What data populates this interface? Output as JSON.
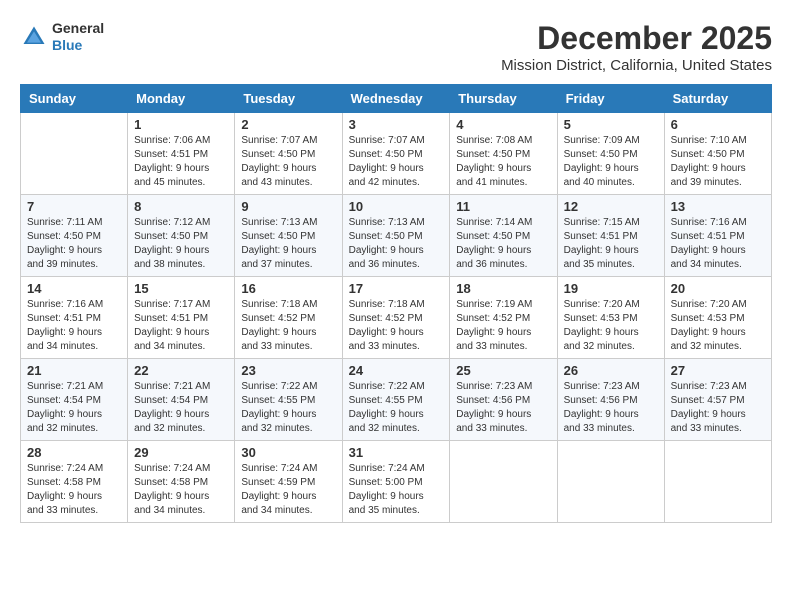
{
  "logo": {
    "general": "General",
    "blue": "Blue"
  },
  "header": {
    "month": "December 2025",
    "location": "Mission District, California, United States"
  },
  "days_of_week": [
    "Sunday",
    "Monday",
    "Tuesday",
    "Wednesday",
    "Thursday",
    "Friday",
    "Saturday"
  ],
  "weeks": [
    [
      {
        "day": "",
        "info": ""
      },
      {
        "day": "1",
        "info": "Sunrise: 7:06 AM\nSunset: 4:51 PM\nDaylight: 9 hours\nand 45 minutes."
      },
      {
        "day": "2",
        "info": "Sunrise: 7:07 AM\nSunset: 4:50 PM\nDaylight: 9 hours\nand 43 minutes."
      },
      {
        "day": "3",
        "info": "Sunrise: 7:07 AM\nSunset: 4:50 PM\nDaylight: 9 hours\nand 42 minutes."
      },
      {
        "day": "4",
        "info": "Sunrise: 7:08 AM\nSunset: 4:50 PM\nDaylight: 9 hours\nand 41 minutes."
      },
      {
        "day": "5",
        "info": "Sunrise: 7:09 AM\nSunset: 4:50 PM\nDaylight: 9 hours\nand 40 minutes."
      },
      {
        "day": "6",
        "info": "Sunrise: 7:10 AM\nSunset: 4:50 PM\nDaylight: 9 hours\nand 39 minutes."
      }
    ],
    [
      {
        "day": "7",
        "info": "Sunrise: 7:11 AM\nSunset: 4:50 PM\nDaylight: 9 hours\nand 39 minutes."
      },
      {
        "day": "8",
        "info": "Sunrise: 7:12 AM\nSunset: 4:50 PM\nDaylight: 9 hours\nand 38 minutes."
      },
      {
        "day": "9",
        "info": "Sunrise: 7:13 AM\nSunset: 4:50 PM\nDaylight: 9 hours\nand 37 minutes."
      },
      {
        "day": "10",
        "info": "Sunrise: 7:13 AM\nSunset: 4:50 PM\nDaylight: 9 hours\nand 36 minutes."
      },
      {
        "day": "11",
        "info": "Sunrise: 7:14 AM\nSunset: 4:50 PM\nDaylight: 9 hours\nand 36 minutes."
      },
      {
        "day": "12",
        "info": "Sunrise: 7:15 AM\nSunset: 4:51 PM\nDaylight: 9 hours\nand 35 minutes."
      },
      {
        "day": "13",
        "info": "Sunrise: 7:16 AM\nSunset: 4:51 PM\nDaylight: 9 hours\nand 34 minutes."
      }
    ],
    [
      {
        "day": "14",
        "info": "Sunrise: 7:16 AM\nSunset: 4:51 PM\nDaylight: 9 hours\nand 34 minutes."
      },
      {
        "day": "15",
        "info": "Sunrise: 7:17 AM\nSunset: 4:51 PM\nDaylight: 9 hours\nand 34 minutes."
      },
      {
        "day": "16",
        "info": "Sunrise: 7:18 AM\nSunset: 4:52 PM\nDaylight: 9 hours\nand 33 minutes."
      },
      {
        "day": "17",
        "info": "Sunrise: 7:18 AM\nSunset: 4:52 PM\nDaylight: 9 hours\nand 33 minutes."
      },
      {
        "day": "18",
        "info": "Sunrise: 7:19 AM\nSunset: 4:52 PM\nDaylight: 9 hours\nand 33 minutes."
      },
      {
        "day": "19",
        "info": "Sunrise: 7:20 AM\nSunset: 4:53 PM\nDaylight: 9 hours\nand 32 minutes."
      },
      {
        "day": "20",
        "info": "Sunrise: 7:20 AM\nSunset: 4:53 PM\nDaylight: 9 hours\nand 32 minutes."
      }
    ],
    [
      {
        "day": "21",
        "info": "Sunrise: 7:21 AM\nSunset: 4:54 PM\nDaylight: 9 hours\nand 32 minutes."
      },
      {
        "day": "22",
        "info": "Sunrise: 7:21 AM\nSunset: 4:54 PM\nDaylight: 9 hours\nand 32 minutes."
      },
      {
        "day": "23",
        "info": "Sunrise: 7:22 AM\nSunset: 4:55 PM\nDaylight: 9 hours\nand 32 minutes."
      },
      {
        "day": "24",
        "info": "Sunrise: 7:22 AM\nSunset: 4:55 PM\nDaylight: 9 hours\nand 32 minutes."
      },
      {
        "day": "25",
        "info": "Sunrise: 7:23 AM\nSunset: 4:56 PM\nDaylight: 9 hours\nand 33 minutes."
      },
      {
        "day": "26",
        "info": "Sunrise: 7:23 AM\nSunset: 4:56 PM\nDaylight: 9 hours\nand 33 minutes."
      },
      {
        "day": "27",
        "info": "Sunrise: 7:23 AM\nSunset: 4:57 PM\nDaylight: 9 hours\nand 33 minutes."
      }
    ],
    [
      {
        "day": "28",
        "info": "Sunrise: 7:24 AM\nSunset: 4:58 PM\nDaylight: 9 hours\nand 33 minutes."
      },
      {
        "day": "29",
        "info": "Sunrise: 7:24 AM\nSunset: 4:58 PM\nDaylight: 9 hours\nand 34 minutes."
      },
      {
        "day": "30",
        "info": "Sunrise: 7:24 AM\nSunset: 4:59 PM\nDaylight: 9 hours\nand 34 minutes."
      },
      {
        "day": "31",
        "info": "Sunrise: 7:24 AM\nSunset: 5:00 PM\nDaylight: 9 hours\nand 35 minutes."
      },
      {
        "day": "",
        "info": ""
      },
      {
        "day": "",
        "info": ""
      },
      {
        "day": "",
        "info": ""
      }
    ]
  ]
}
